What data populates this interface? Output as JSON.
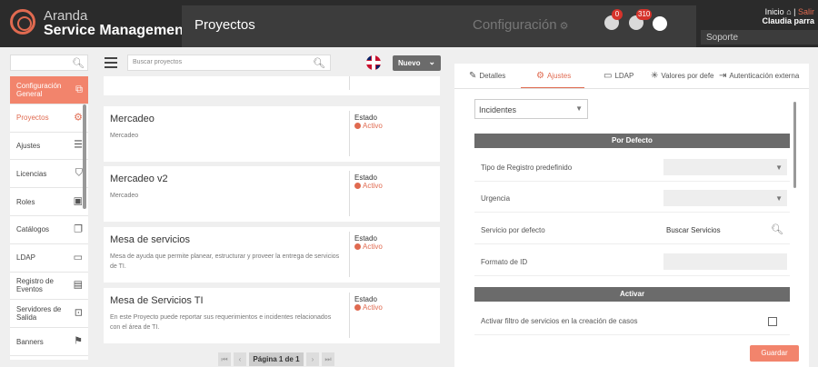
{
  "brand": {
    "line1": "Aranda",
    "line2": "Service Management"
  },
  "header": {
    "page_title": "Proyectos",
    "config_label": "Configuración",
    "cloud_badge": "0",
    "bell_badge": "310",
    "inicio": "Inicio",
    "salir": "Salir",
    "user_name": "Claudia parra",
    "role_select": "Soporte"
  },
  "sidebar": {
    "items": [
      {
        "label": "Configuración General",
        "icon": "copy-icon",
        "glyph": "⧉"
      },
      {
        "label": "Proyectos",
        "icon": "gear-icon",
        "glyph": "⚙"
      },
      {
        "label": "Ajustes",
        "icon": "sliders-icon",
        "glyph": "☰"
      },
      {
        "label": "Licencias",
        "icon": "shield-icon",
        "glyph": "⛉"
      },
      {
        "label": "Roles",
        "icon": "id-card-icon",
        "glyph": "▣"
      },
      {
        "label": "Catálogos",
        "icon": "catalog-icon",
        "glyph": "❐"
      },
      {
        "label": "LDAP",
        "icon": "folder-icon",
        "glyph": "▭"
      },
      {
        "label": "Registro de Eventos",
        "icon": "log-icon",
        "glyph": "▤"
      },
      {
        "label": "Servidores de Salida",
        "icon": "server-icon",
        "glyph": "⊡"
      },
      {
        "label": "Banners",
        "icon": "flag-icon",
        "glyph": "⚑"
      }
    ]
  },
  "projects": {
    "search_placeholder": "Buscar proyectos",
    "new_label": "Nuevo",
    "status_label": "Estado",
    "items": [
      {
        "name": "",
        "desc": "",
        "status": ""
      },
      {
        "name": "Mercadeo",
        "desc": "Mercadeo",
        "status": "Activo"
      },
      {
        "name": "Mercadeo v2",
        "desc": "Mercadeo",
        "status": "Activo"
      },
      {
        "name": "Mesa de servicios",
        "desc": "Mesa de ayuda que permite planear, estructurar y proveer la entrega de servicios de TI.",
        "status": "Activo"
      },
      {
        "name": "Mesa de Servicios TI",
        "desc": "En este Proyecto puede reportar sus requerimientos e incidentes relacionados con el área de TI.",
        "status": "Activo"
      }
    ],
    "page_label": "Página 1 de 1"
  },
  "details": {
    "tabs": [
      "Detalles",
      "Ajustes",
      "LDAP",
      "Valores por defe",
      "Autenticación externa"
    ],
    "active_tab": "Ajustes",
    "type_select": "Incidentes",
    "section_default": "Por Defecto",
    "fields": {
      "tipo_registro": "Tipo de Registro predefinido",
      "urgencia": "Urgencia",
      "servicio": "Servicio por defecto",
      "servicio_placeholder": "Buscar Servicios",
      "formato_id": "Formato de ID"
    },
    "section_activar": "Activar",
    "filtro_label": "Activar filtro de servicios en la creación de casos",
    "filtro_checked": false,
    "save_label": "Guardar"
  },
  "colors": {
    "accent": "#e06a50",
    "accent_light": "#f2846c",
    "topbar": "#2b2b2b",
    "section": "#6b6b6b"
  }
}
